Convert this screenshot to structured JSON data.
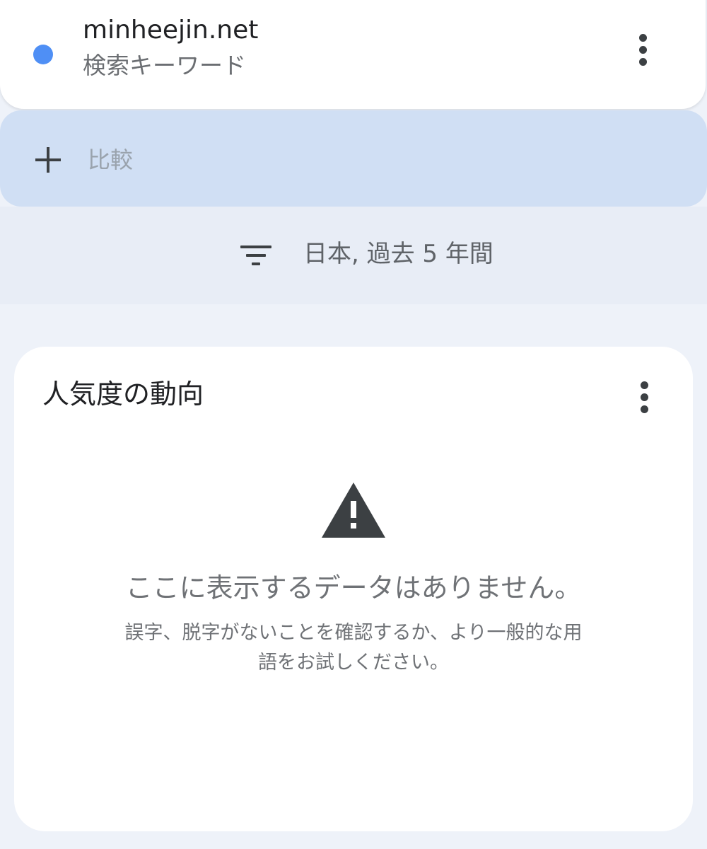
{
  "search_term": {
    "name": "minheejin.net",
    "type": "検索キーワード",
    "color": "#4f8ff5"
  },
  "compare": {
    "label": "比較"
  },
  "filter": {
    "label": "日本, 過去 5 年間",
    "icon": "filter-list-icon"
  },
  "interest_card": {
    "title": "人気度の動向",
    "empty_title": "ここに表示するデータはありません。",
    "empty_hint_line1": "誤字、脱字がないことを確認するか、より一般的な用",
    "empty_hint_line2": "語をお試しください。",
    "icon": "warning-icon"
  },
  "colors": {
    "compare_bar": "#d0dff4",
    "background": "#eef2f9",
    "accent_dot": "#4f8ff5"
  }
}
